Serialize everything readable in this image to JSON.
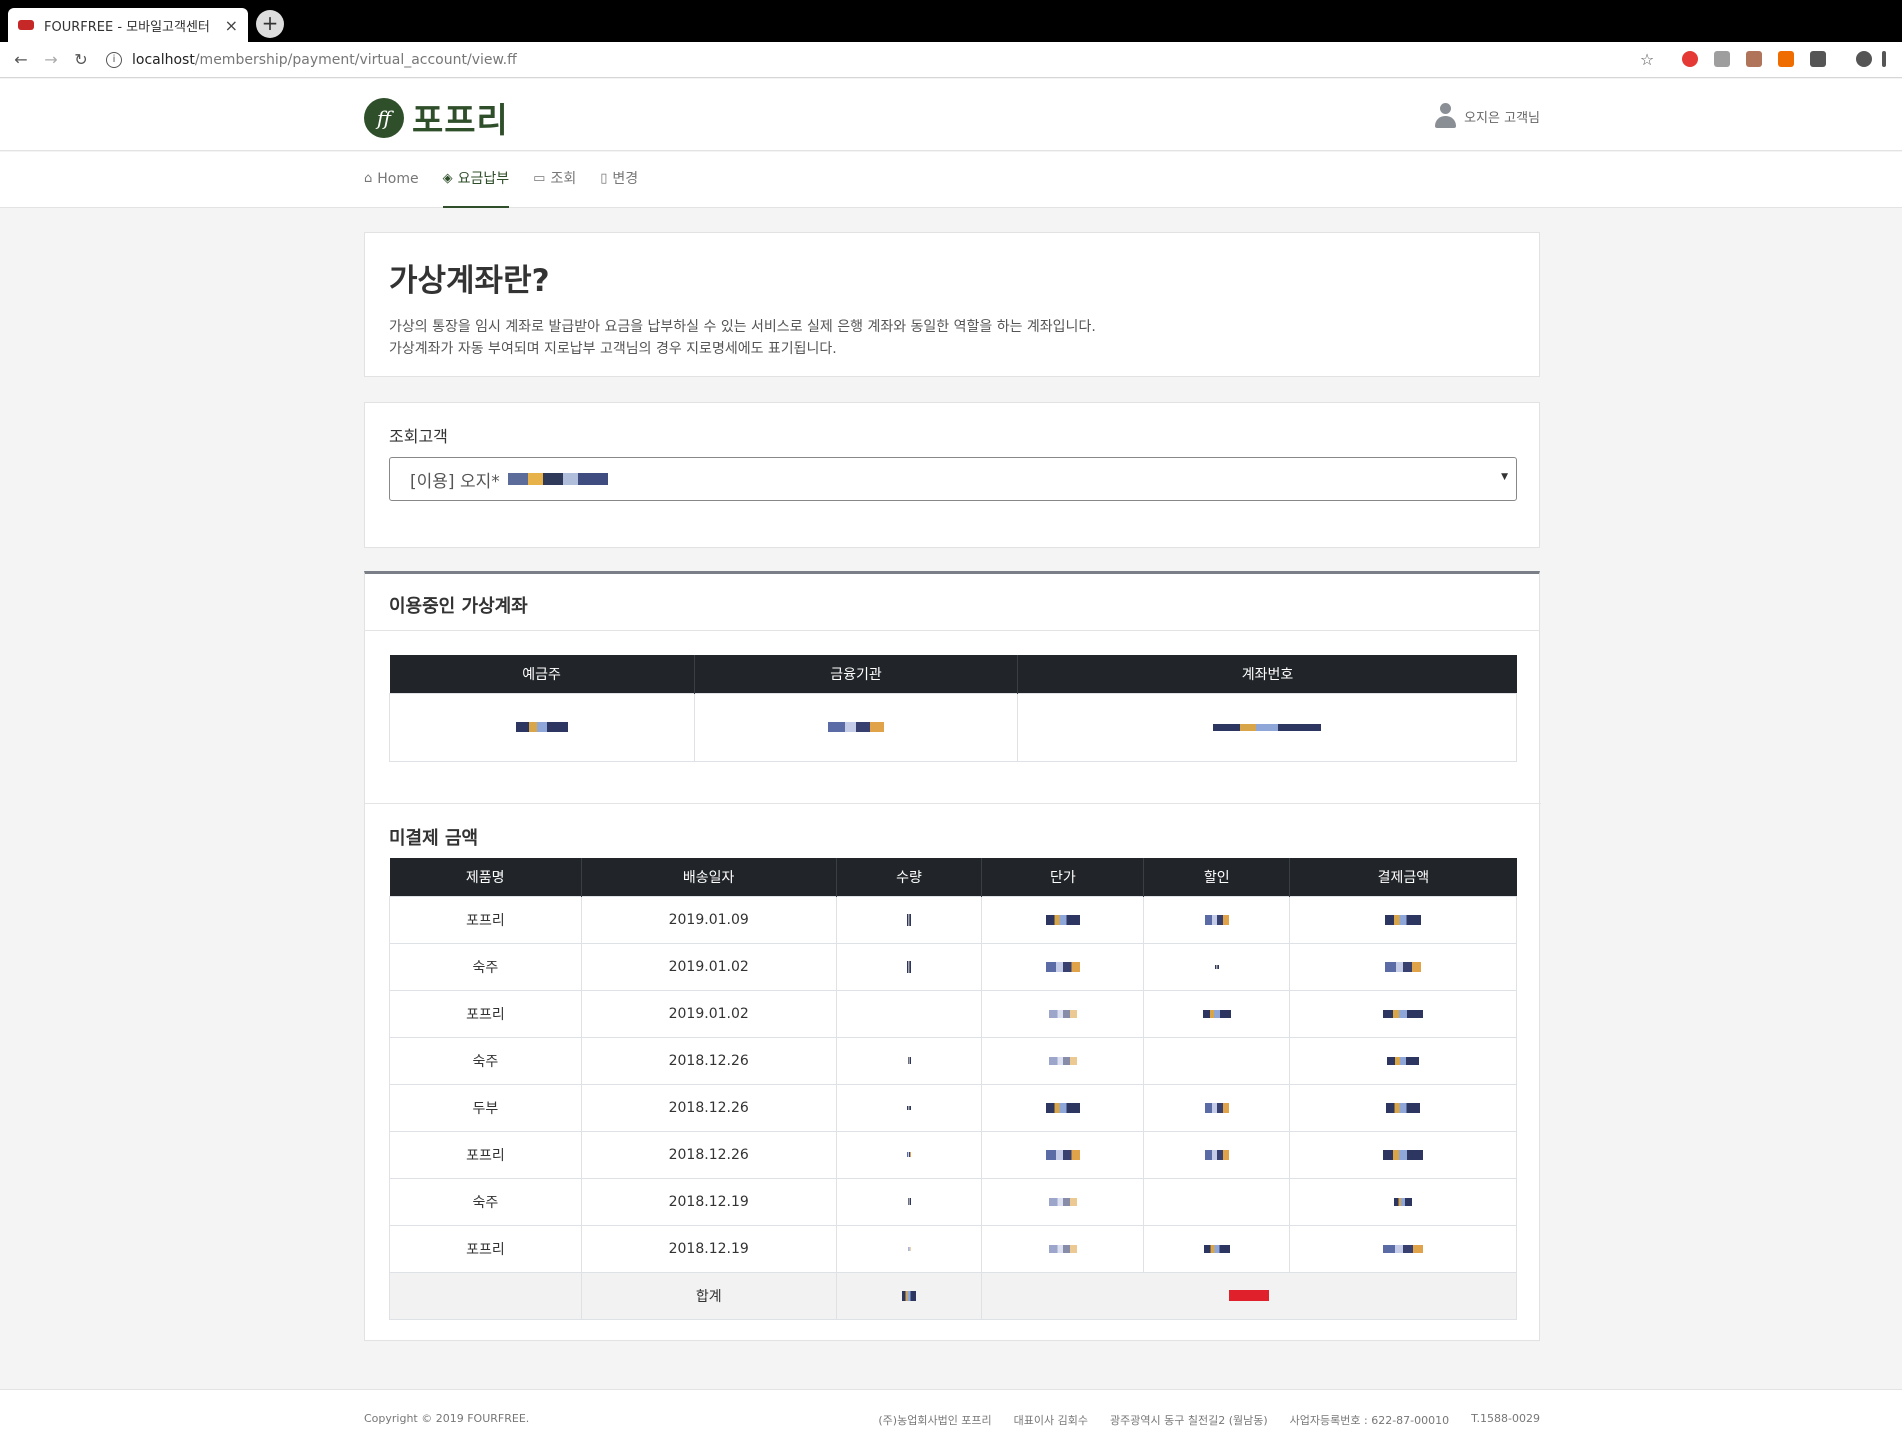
{
  "browser": {
    "tab_title": "FOURFREE - 모바일고객센터",
    "tab_close": "×",
    "new_tab": "+",
    "url_host": "localhost",
    "url_path": "/membership/payment/virtual_account/view.ff"
  },
  "header": {
    "logo_text": "포프리",
    "user_name": "오지은 고객님"
  },
  "nav": {
    "items": [
      {
        "label": "Home",
        "icon": "home-icon"
      },
      {
        "label": "요금납부",
        "icon": "box-icon"
      },
      {
        "label": "조회",
        "icon": "calendar-icon"
      },
      {
        "label": "변경",
        "icon": "file-icon"
      }
    ]
  },
  "intro": {
    "title": "가상계좌란?",
    "line1": "가상의 통장을 임시 계좌로 발급받아 요금을 납부하실 수 있는 서비스로 실제 은행 계좌와 동일한 역할을 하는 계좌입니다.",
    "line2": "가상계좌가 자동 부여되며 지로납부 고객님의 경우 지로명세에도 표기됩니다."
  },
  "customer": {
    "label": "조회고객",
    "selected": "[이용] 오지*"
  },
  "virtual_account": {
    "title": "이용중인 가상계좌",
    "columns": [
      "예금주",
      "금융기관",
      "계좌번호"
    ]
  },
  "unpaid": {
    "title": "미결제 금액",
    "columns": [
      "제품명",
      "배송일자",
      "수량",
      "단가",
      "할인",
      "결제금액"
    ],
    "rows": [
      {
        "product": "포프리",
        "date": "2019.01.09"
      },
      {
        "product": "숙주",
        "date": "2019.01.02"
      },
      {
        "product": "포프리",
        "date": "2019.01.02"
      },
      {
        "product": "숙주",
        "date": "2018.12.26"
      },
      {
        "product": "두부",
        "date": "2018.12.26"
      },
      {
        "product": "포프리",
        "date": "2018.12.26"
      },
      {
        "product": "숙주",
        "date": "2018.12.19"
      },
      {
        "product": "포프리",
        "date": "2018.12.19"
      }
    ],
    "total_label": "합계"
  },
  "footer": {
    "copyright": "Copyright © 2019 FOURFREE.",
    "company": "(주)농업회사법인 포프리",
    "ceo": "대표이사 김회수",
    "address": "광주광역시 동구 칠전길2 (월남동)",
    "biz_no": "사업자등록번호 : 622-87-00010",
    "tel": "T.1588-0029"
  }
}
